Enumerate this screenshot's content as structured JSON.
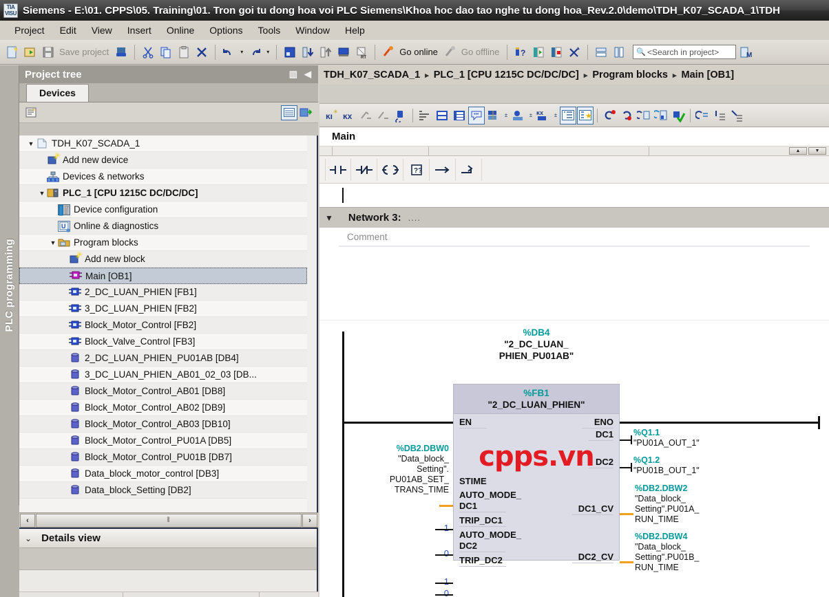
{
  "window": {
    "app_icon": "tia-portal-icon",
    "title": "Siemens  -  E:\\01. CPPS\\05. Training\\01. Tron goi tu dong hoa voi PLC Siemens\\Khoa hoc dao tao nghe tu dong hoa_Rev.2.0\\demo\\TDH_K07_SCADA_1\\TDH"
  },
  "menu": {
    "items": [
      "Project",
      "Edit",
      "View",
      "Insert",
      "Online",
      "Options",
      "Tools",
      "Window",
      "Help"
    ]
  },
  "toolbar": {
    "new_project_label": "new-project-icon",
    "open_project_label": "open-project-icon",
    "save_project_label": "Save project",
    "go_online_label": "Go online",
    "go_offline_label": "Go offline",
    "search_placeholder": "<Search in project>"
  },
  "vertical_tab": {
    "label": "PLC programming"
  },
  "project_tree": {
    "header": "Project tree",
    "tab": "Devices",
    "items": [
      {
        "label": "TDH_K07_SCADA_1",
        "indent": 0,
        "twisty": "▼",
        "icon": "project-icon",
        "bold": false,
        "selected": false
      },
      {
        "label": "Add new device",
        "indent": 1,
        "twisty": "",
        "icon": "add-new-device-icon",
        "bold": false,
        "selected": false
      },
      {
        "label": "Devices & networks",
        "indent": 1,
        "twisty": "",
        "icon": "devices-networks-icon",
        "bold": false,
        "selected": false
      },
      {
        "label": "PLC_1 [CPU 1215C DC/DC/DC]",
        "indent": 1,
        "twisty": "▼",
        "icon": "plc-icon",
        "bold": true,
        "selected": false
      },
      {
        "label": "Device configuration",
        "indent": 2,
        "twisty": "",
        "icon": "device-configuration-icon",
        "bold": false,
        "selected": false
      },
      {
        "label": "Online & diagnostics",
        "indent": 2,
        "twisty": "",
        "icon": "online-diagnostics-icon",
        "bold": false,
        "selected": false
      },
      {
        "label": "Program blocks",
        "indent": 2,
        "twisty": "▼",
        "icon": "folder-icon",
        "bold": false,
        "selected": false
      },
      {
        "label": "Add new block",
        "indent": 3,
        "twisty": "",
        "icon": "add-new-block-icon",
        "bold": false,
        "selected": false
      },
      {
        "label": "Main [OB1]",
        "indent": 3,
        "twisty": "",
        "icon": "ob-block-icon",
        "bold": false,
        "selected": true
      },
      {
        "label": "2_DC_LUAN_PHIEN [FB1]",
        "indent": 3,
        "twisty": "",
        "icon": "fb-block-icon",
        "bold": false,
        "selected": false
      },
      {
        "label": "3_DC_LUAN_PHIEN [FB2]",
        "indent": 3,
        "twisty": "",
        "icon": "fb-block-icon",
        "bold": false,
        "selected": false
      },
      {
        "label": "Block_Motor_Control [FB2]",
        "indent": 3,
        "twisty": "",
        "icon": "fb-block-icon",
        "bold": false,
        "selected": false
      },
      {
        "label": "Block_Valve_Control [FB3]",
        "indent": 3,
        "twisty": "",
        "icon": "fb-block-icon",
        "bold": false,
        "selected": false
      },
      {
        "label": "2_DC_LUAN_PHIEN_PU01AB [DB4]",
        "indent": 3,
        "twisty": "",
        "icon": "db-block-icon",
        "bold": false,
        "selected": false
      },
      {
        "label": "3_DC_LUAN_PHIEN_AB01_02_03 [DB...",
        "indent": 3,
        "twisty": "",
        "icon": "db-block-icon",
        "bold": false,
        "selected": false
      },
      {
        "label": "Block_Motor_Control_AB01 [DB8]",
        "indent": 3,
        "twisty": "",
        "icon": "db-block-icon",
        "bold": false,
        "selected": false
      },
      {
        "label": "Block_Motor_Control_AB02 [DB9]",
        "indent": 3,
        "twisty": "",
        "icon": "db-block-icon",
        "bold": false,
        "selected": false
      },
      {
        "label": "Block_Motor_Control_AB03 [DB10]",
        "indent": 3,
        "twisty": "",
        "icon": "db-block-icon",
        "bold": false,
        "selected": false
      },
      {
        "label": "Block_Motor_Control_PU01A [DB5]",
        "indent": 3,
        "twisty": "",
        "icon": "db-block-icon",
        "bold": false,
        "selected": false
      },
      {
        "label": "Block_Motor_Control_PU01B [DB7]",
        "indent": 3,
        "twisty": "",
        "icon": "db-block-icon",
        "bold": false,
        "selected": false
      },
      {
        "label": "Data_block_motor_control [DB3]",
        "indent": 3,
        "twisty": "",
        "icon": "db-block-icon",
        "bold": false,
        "selected": false
      },
      {
        "label": "Data_block_Setting [DB2]",
        "indent": 3,
        "twisty": "",
        "icon": "db-block-icon",
        "bold": false,
        "selected": false
      }
    ]
  },
  "details_view": {
    "title": "Details view"
  },
  "editor": {
    "breadcrumb": [
      "TDH_K07_SCADA_1",
      "PLC_1 [CPU 1215C DC/DC/DC]",
      "Program blocks",
      "Main [OB1]"
    ],
    "breadcrumb_sep": "▸",
    "block_title": "Main",
    "ladder_palette": [
      "┤├",
      "┤/├",
      "─()─",
      "??",
      "→",
      "→"
    ],
    "network": {
      "twisty": "▼",
      "title": "Network 3:",
      "dots": "....",
      "comment": "Comment"
    }
  },
  "fb_call": {
    "instance_db": "%DB4",
    "instance_name_line1": "\"2_DC_LUAN_",
    "instance_name_line2": "PHIEN_PU01AB\"",
    "fb_number": "%FB1",
    "fb_name": "\"2_DC_LUAN_PHIEN\"",
    "en_label": "EN",
    "eno_label": "ENO",
    "watermark": "cpps.vn",
    "watermark_color": "#e31b23",
    "inputs": [
      {
        "pin": "STIME",
        "pin2": "",
        "operand_addr": "%DB2.DBW0",
        "operand_lines": [
          "\"Data_block_",
          "Setting\".",
          "PU01AB_SET_",
          "TRANS_TIME"
        ],
        "value": "",
        "wire": "orange"
      },
      {
        "pin": "AUTO_MODE_",
        "pin2": "DC1",
        "operand_addr": "",
        "operand_lines": [],
        "value": "1",
        "wire": "black"
      },
      {
        "pin": "TRIP_DC1",
        "pin2": "",
        "operand_addr": "",
        "operand_lines": [],
        "value": "0",
        "wire": "black"
      },
      {
        "pin": "AUTO_MODE_",
        "pin2": "DC2",
        "operand_addr": "",
        "operand_lines": [],
        "value": "1",
        "wire": "black"
      },
      {
        "pin": "TRIP_DC2",
        "pin2": "",
        "operand_addr": "",
        "operand_lines": [],
        "value": "0",
        "wire": "black"
      }
    ],
    "outputs": [
      {
        "pin": "DC1",
        "operand_addr": "%Q1.1",
        "operand_lines": [
          "\"PU01A_OUT_1\""
        ],
        "wire": "arrow"
      },
      {
        "pin": "DC2",
        "operand_addr": "%Q1.2",
        "operand_lines": [
          "\"PU01B_OUT_1\""
        ],
        "wire": "arrow"
      },
      {
        "pin": "DC1_CV",
        "operand_addr": "%DB2.DBW2",
        "operand_lines": [
          "\"Data_block_",
          "Setting\".PU01A_",
          "RUN_TIME"
        ],
        "wire": "orange"
      },
      {
        "pin": "DC2_CV",
        "operand_addr": "%DB2.DBW4",
        "operand_lines": [
          "\"Data_block_",
          "Setting\".PU01B_",
          "RUN_TIME"
        ],
        "wire": "orange"
      }
    ]
  },
  "colors": {
    "teal_address": "#009a9a",
    "orange_wire": "#f0a01e",
    "const_blue": "#2a52be",
    "selection": "#c3ccd6"
  }
}
